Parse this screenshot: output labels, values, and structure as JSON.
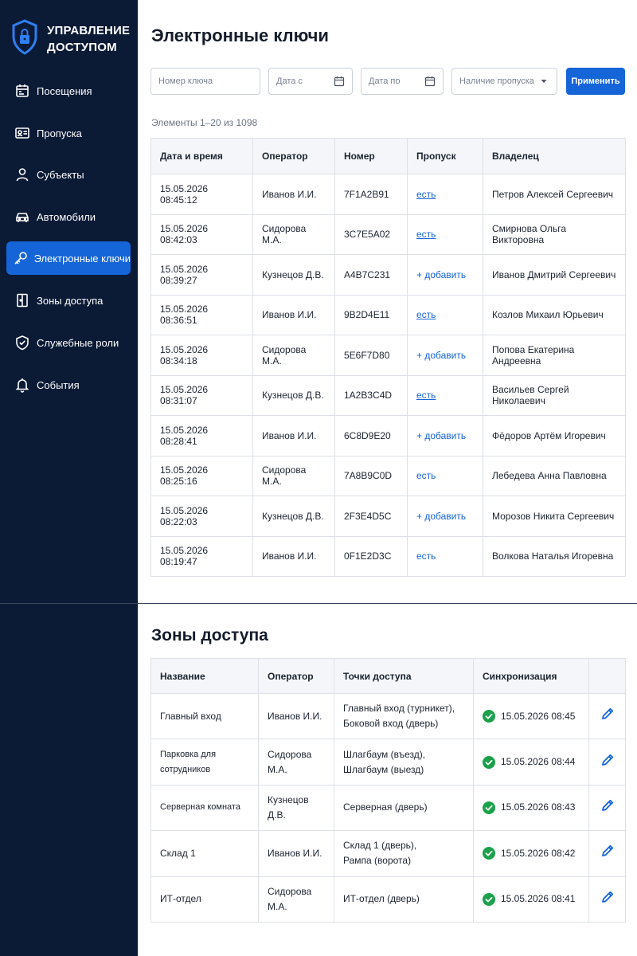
{
  "brand": {
    "title": "УПРАВЛЕНИЕ\nДОСТУПОМ",
    "icon": "shield-lock-icon"
  },
  "colors": {
    "sidebar_bg": "#0b1a35",
    "accent": "#1565d8",
    "success": "#1aa14a"
  },
  "sidebar": {
    "items": [
      {
        "label": "Посещения",
        "icon": "calendar-icon",
        "active": false
      },
      {
        "label": "Пропуска",
        "icon": "id-card-icon",
        "active": false
      },
      {
        "label": "Субъекты",
        "icon": "user-icon",
        "active": false
      },
      {
        "label": "Автомобили",
        "icon": "car-icon",
        "active": false
      },
      {
        "label": "Электронные ключи",
        "icon": "key-icon",
        "active": true
      },
      {
        "label": "Зоны доступа",
        "icon": "door-icon",
        "active": false
      },
      {
        "label": "Служебные роли",
        "icon": "shield-check-icon",
        "active": false
      },
      {
        "label": "События",
        "icon": "bell-icon",
        "active": false
      }
    ]
  },
  "keys": {
    "title": "Электронные ключи",
    "filters": {
      "key_number_placeholder": "Номер ключа",
      "date_from_placeholder": "Дата с",
      "date_to_placeholder": "Дата по",
      "pass_select_value": "Наличие пропуска",
      "apply_label": "Применить"
    },
    "count_text": "Элементы 1–20 из 1098",
    "columns": [
      "Дата и время",
      "Оператор",
      "Номер",
      "Пропуск",
      "Владелец"
    ],
    "rows": [
      {
        "datetime": "15.05.2026  08:45:12",
        "operator": "Иванов И.И.",
        "number": "7F1A2B91",
        "pass": "есть",
        "pass_style": "link",
        "owner": "Петров Алексей Сергеевич"
      },
      {
        "datetime": "15.05.2026  08:42:03",
        "operator": "Сидорова М.А.",
        "number": "3C7E5A02",
        "pass": "есть",
        "pass_style": "link",
        "owner": "Смирнова Ольга Викторовна"
      },
      {
        "datetime": "15.05.2026  08:39:27",
        "operator": "Кузнецов Д.В.",
        "number": "A4B7C231",
        "pass": "+ добавить",
        "pass_style": "add",
        "owner": "Иванов Дмитрий Сергеевич"
      },
      {
        "datetime": "15.05.2026  08:36:51",
        "operator": "Иванов И.И.",
        "number": "9B2D4E11",
        "pass": "есть",
        "pass_style": "link",
        "owner": "Козлов Михаил Юрьевич"
      },
      {
        "datetime": "15.05.2026  08:34:18",
        "operator": "Сидорова М.А.",
        "number": "5E6F7D80",
        "pass": "+ добавить",
        "pass_style": "add",
        "owner": "Попова Екатерина Андреевна"
      },
      {
        "datetime": "15.05.2026  08:31:07",
        "operator": "Кузнецов Д.В.",
        "number": "1A2B3C4D",
        "pass": "есть",
        "pass_style": "link",
        "owner": "Васильев Сергей Николаевич"
      },
      {
        "datetime": "15.05.2026  08:28:41",
        "operator": "Иванов И.И.",
        "number": "6C8D9E20",
        "pass": "+ добавить",
        "pass_style": "add",
        "owner": "Фёдоров Артём Игоревич"
      },
      {
        "datetime": "15.05.2026  08:25:16",
        "operator": "Сидорова М.А.",
        "number": "7A8B9C0D",
        "pass": "есть",
        "pass_style": "plain",
        "owner": "Лебедева Анна Павловна"
      },
      {
        "datetime": "15.05.2026  08:22:03",
        "operator": "Кузнецов Д.В.",
        "number": "2F3E4D5C",
        "pass": "+ добавить",
        "pass_style": "add",
        "owner": "Морозов Никита Сергеевич"
      },
      {
        "datetime": "15.05.2026  08:19:47",
        "operator": "Иванов И.И.",
        "number": "0F1E2D3C",
        "pass": "есть",
        "pass_style": "plain",
        "owner": "Волкова Наталья Игоревна"
      }
    ]
  },
  "zones": {
    "title": "Зоны доступа",
    "columns": [
      "Название",
      "Оператор",
      "Точки доступа",
      "Синхронизация",
      ""
    ],
    "rows": [
      {
        "name": "Главный вход",
        "operator": "Иванов И.И.",
        "points": "Главный вход (турникет),\nБоковой вход (дверь)",
        "sync": "15.05.2026 08:45",
        "small": false
      },
      {
        "name": "Парковка для сотрудников",
        "operator": "Сидорова М.А.",
        "points": "Шлагбаум (въезд),\nШлагбаум (выезд)",
        "sync": "15.05.2026 08:44",
        "small": true
      },
      {
        "name": "Серверная комната",
        "operator": "Кузнецов Д.В.",
        "points": "Серверная (дверь)",
        "sync": "15.05.2026 08:43",
        "small": true
      },
      {
        "name": "Склад 1",
        "operator": "Иванов И.И.",
        "points": "Склад 1 (дверь),\nРампа (ворота)",
        "sync": "15.05.2026 08:42",
        "small": false
      },
      {
        "name": "ИТ-отдел",
        "operator": "Сидорова М.А.",
        "points": "ИТ-отдел (дверь)",
        "sync": "15.05.2026 08:41",
        "small": false
      }
    ]
  }
}
